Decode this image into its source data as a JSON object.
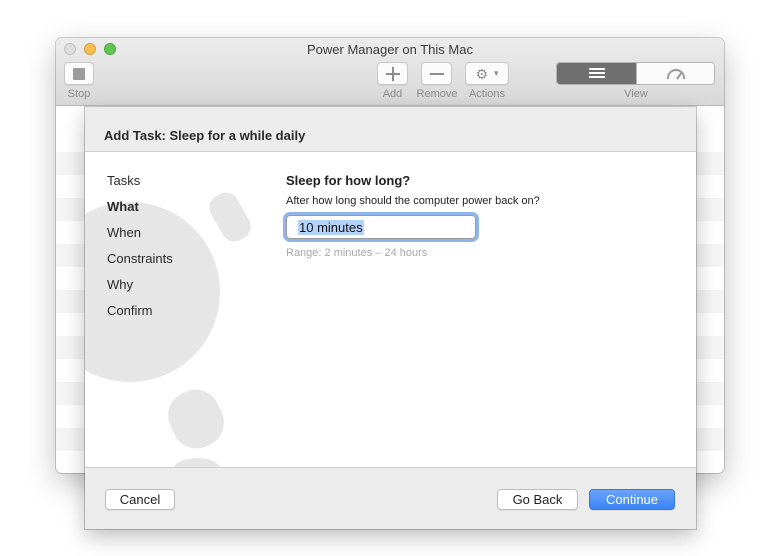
{
  "window": {
    "title": "Power Manager on This Mac"
  },
  "toolbar": {
    "stop_label": "Stop",
    "add_label": "Add",
    "remove_label": "Remove",
    "actions_label": "Actions",
    "view_label": "View",
    "view_selected": "list"
  },
  "sheet": {
    "title": "Add Task: Sleep for a while daily",
    "steps": [
      {
        "label": "Tasks",
        "active": false
      },
      {
        "label": "What",
        "active": true
      },
      {
        "label": "When",
        "active": false
      },
      {
        "label": "Constraints",
        "active": false
      },
      {
        "label": "Why",
        "active": false
      },
      {
        "label": "Confirm",
        "active": false
      }
    ],
    "question": "Sleep for how long?",
    "prompt": "After how long should the computer power back on?",
    "duration_value": "10 minutes",
    "range_hint": "Range: 2 minutes – 24 hours",
    "buttons": {
      "cancel": "Cancel",
      "back": "Go Back",
      "continue": "Continue"
    }
  },
  "colors": {
    "accent": "#3a84f5",
    "focus_ring": "#8fb5ec",
    "selection": "#b4d3f8"
  },
  "icons": [
    "stop-icon",
    "plus-icon",
    "minus-icon",
    "gear-icon",
    "chevron-down-icon",
    "list-view-icon",
    "gauge-icon"
  ]
}
